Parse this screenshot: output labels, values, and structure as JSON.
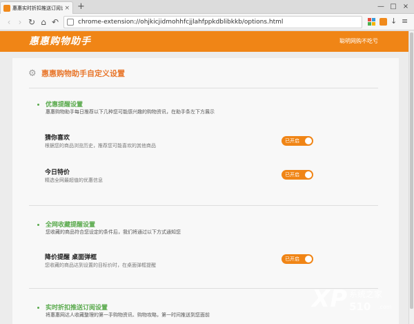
{
  "browser": {
    "tab_title": "惠惠实时折扣推送订阅设置",
    "tab_close": "×",
    "new_tab": "+",
    "window_controls": [
      "—",
      "□",
      "×"
    ],
    "url": "chrome-extension://ohjkicjidmohhfcjjlahfppkdblibkkb/options.html",
    "nav_icons": [
      "back-icon",
      "forward-icon",
      "reload-icon",
      "home-icon",
      "undo-icon"
    ],
    "nav_glyphs": [
      "‹",
      "›",
      "↻",
      "⌂",
      "↶"
    ],
    "url_chevron": "⌄",
    "tool_glyphs": {
      "download": "↓",
      "menu": "≡"
    }
  },
  "header": {
    "logo": "惠惠购物助手",
    "slogan": "聪明网购不吃亏"
  },
  "page": {
    "gear_glyph": "⚙",
    "title": "惠惠购物助手自定义设置",
    "sections": [
      {
        "title": "优惠提醒设置",
        "desc": "惠惠购物助手每日推荐以下几种您可能感兴趣的购物资讯，在助手条左下方展示",
        "rows": [
          {
            "title": "猜你喜欢",
            "desc": "根据您的商品浏览历史，推荐您可能喜欢的其他商品",
            "toggle": "已开启"
          },
          {
            "title": "今日特价",
            "desc": "精选全网最超值的优惠信息",
            "toggle": "已开启"
          }
        ]
      },
      {
        "title": "全网收藏提醒设置",
        "desc": "您收藏的商品符合您设定的条件后，我们将通过以下方式通知您",
        "rows": [
          {
            "title": "降价提醒 桌面弹框",
            "desc": "您收藏的商品达到设置的目标价时，在桌面弹框提醒",
            "toggle": "已开启"
          }
        ]
      },
      {
        "title": "实时折扣推送订阅设置",
        "desc": "将惠惠网达人收藏整理的第一手购物资讯、购物攻略，第一时间推送到您面前",
        "rows": []
      }
    ]
  },
  "watermark": {
    "logo": "XP",
    "cn": "系统之家",
    "num": "510",
    "domain": ".com"
  },
  "colors": {
    "accent": "#f08516",
    "section_green": "#5aaa4d",
    "title_orange": "#e8762b"
  }
}
